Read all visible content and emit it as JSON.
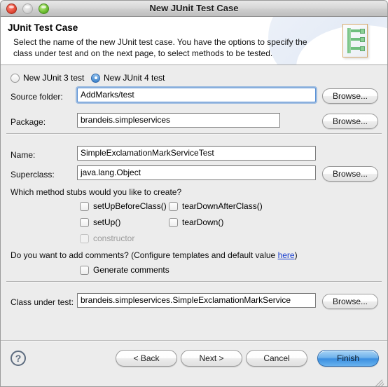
{
  "window": {
    "title": "New JUnit Test Case",
    "traffic_lights": [
      "close-button",
      "minimize-button",
      "zoom-button"
    ]
  },
  "header": {
    "title": "JUnit Test Case",
    "description": "Select the name of the new JUnit test case. You have the options to specify the class under test and on the next page, to select methods to be tested.",
    "icon": "junit-wizard-banner-icon"
  },
  "version_choice": {
    "junit3": {
      "label": "New JUnit 3 test",
      "selected": false
    },
    "junit4": {
      "label": "New JUnit 4 test",
      "selected": true
    }
  },
  "fields": {
    "source_folder": {
      "label": "Source folder:",
      "value": "AddMarks/test",
      "placeholder": "",
      "focused": true,
      "browse": "Browse..."
    },
    "package": {
      "label": "Package:",
      "value": "brandeis.simpleservices",
      "placeholder": "",
      "focused": false,
      "browse": "Browse..."
    },
    "name": {
      "label": "Name:",
      "value": "SimpleExclamationMarkServiceTest",
      "placeholder": "",
      "focused": false
    },
    "superclass": {
      "label": "Superclass:",
      "value": "java.lang.Object",
      "placeholder": "",
      "focused": false,
      "browse": "Browse..."
    },
    "class_under_test": {
      "label": "Class under test:",
      "value": "brandeis.simpleservices.SimpleExclamationMarkService",
      "placeholder": "",
      "focused": false,
      "browse": "Browse..."
    }
  },
  "stubs": {
    "prompt": "Which method stubs would you like to create?",
    "items": [
      {
        "label": "setUpBeforeClass()",
        "checked": false,
        "enabled": true
      },
      {
        "label": "tearDownAfterClass()",
        "checked": false,
        "enabled": true
      },
      {
        "label": "setUp()",
        "checked": false,
        "enabled": true
      },
      {
        "label": "tearDown()",
        "checked": false,
        "enabled": true
      },
      {
        "label": "constructor",
        "checked": false,
        "enabled": false
      }
    ]
  },
  "comments": {
    "prompt_before": "Do you want to add comments? (Configure templates and default value ",
    "link": "here",
    "prompt_after": ")",
    "generate": {
      "label": "Generate comments",
      "checked": false
    }
  },
  "footer": {
    "help": "?",
    "back": "< Back",
    "next": "Next >",
    "cancel": "Cancel",
    "finish": "Finish"
  },
  "colors": {
    "accent_blue": "#3b8fe0",
    "link_blue": "#1a3fd0",
    "window_bg": "#ececec",
    "focus_ring": "#5b92d6"
  }
}
